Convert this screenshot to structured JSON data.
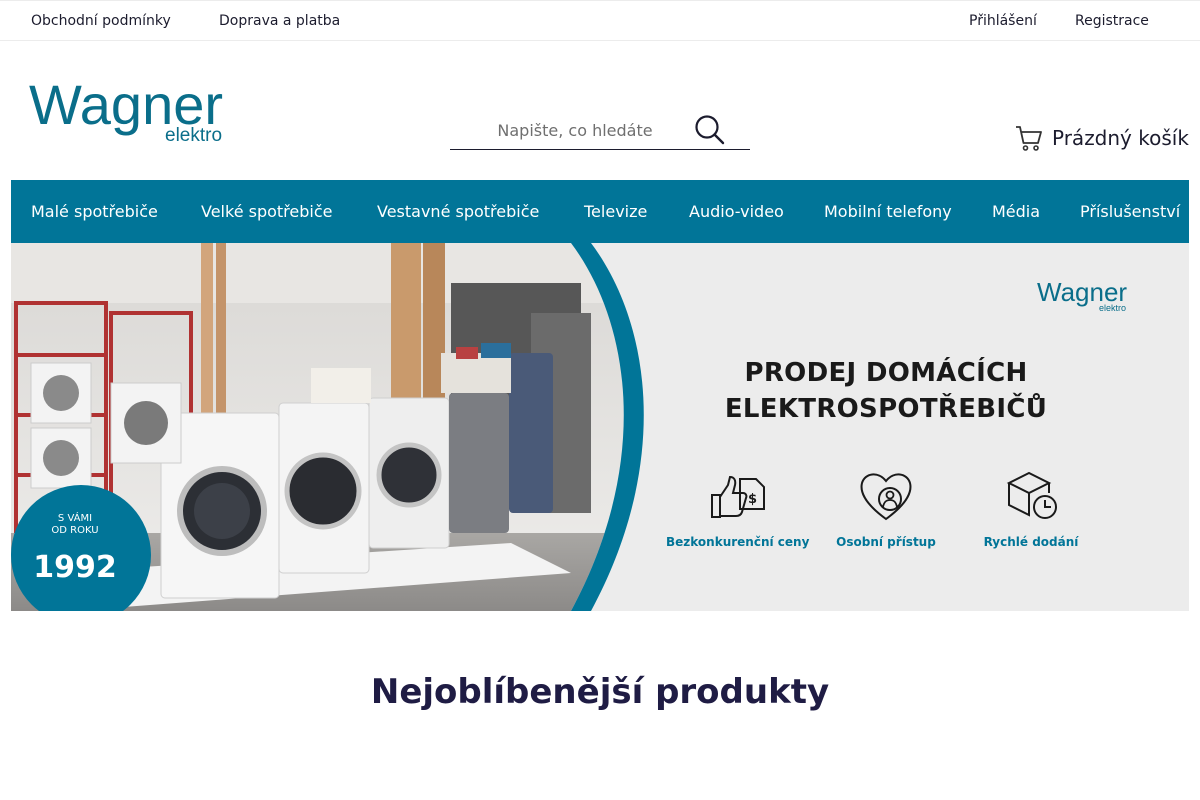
{
  "topbar": {
    "left_links": [
      "Obchodní podmínky",
      "Doprava a platba"
    ],
    "right_links": [
      "Přihlášení",
      "Registrace"
    ]
  },
  "header": {
    "logo": {
      "wordmark": "Wagner",
      "subtitle": "elektro",
      "color": "#0a6e8a"
    },
    "search": {
      "placeholder": "Napište, co hledáte",
      "value": "",
      "icon": "search-icon"
    },
    "cart": {
      "label": "Prázdný košík",
      "icon": "cart-icon"
    }
  },
  "nav": {
    "background": "#017598",
    "items": [
      "Malé spotřebiče",
      "Velké spotřebiče",
      "Vestavné spotřebiče",
      "Televize",
      "Audio-video",
      "Mobilní telefony",
      "Média",
      "Příslušenství"
    ]
  },
  "banner": {
    "badge": {
      "line1": "S VÁMI",
      "line2": "OD ROKU",
      "year": "1992"
    },
    "logo": {
      "wordmark": "Wagner",
      "subtitle": "elektro"
    },
    "headline": [
      "PRODEJ DOMÁCÍCH",
      "ELEKTROSPOTŘEBIČŮ"
    ],
    "features": [
      {
        "label": "Bezkonkurenční ceny",
        "icon": "price-tag-thumbs-up-icon"
      },
      {
        "label": "Osobní přístup",
        "icon": "heart-person-icon"
      },
      {
        "label": "Rychlé dodání",
        "icon": "package-clock-icon"
      }
    ],
    "accent": "#017598"
  },
  "section": {
    "title": "Nejoblíbenější produkty"
  }
}
